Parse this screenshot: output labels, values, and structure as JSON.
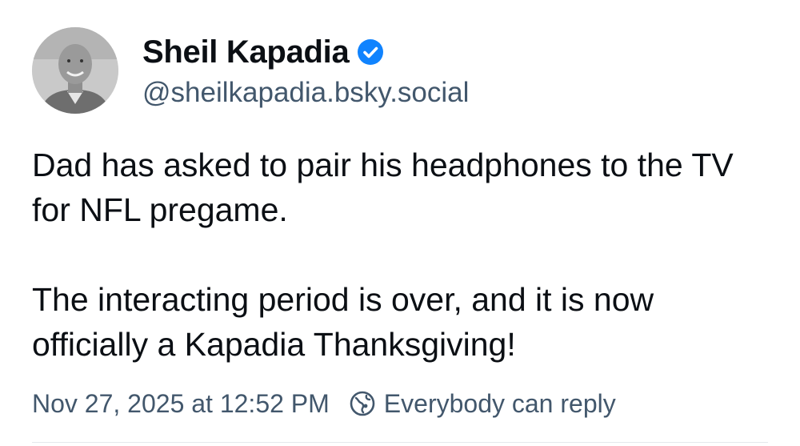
{
  "author": {
    "display_name": "Sheil Kapadia",
    "handle": "@sheilkapadia.bsky.social",
    "verified": true,
    "verified_icon": "verified-check-icon",
    "avatar_icon": "avatar-photo"
  },
  "post": {
    "paragraphs": [
      "Dad has asked to pair his headphones to the TV for NFL pregame.",
      "The interacting period is over, and it is now officially a Kapadia Thanksgiving!"
    ],
    "timestamp": "Nov 27, 2025 at 12:52 PM",
    "reply_setting": "Everybody can reply",
    "reply_setting_icon": "globe-icon"
  },
  "colors": {
    "text_primary": "#0b0f14",
    "text_secondary": "#42576c",
    "verified_badge": "#1083fe",
    "divider": "#e4e8ec"
  }
}
